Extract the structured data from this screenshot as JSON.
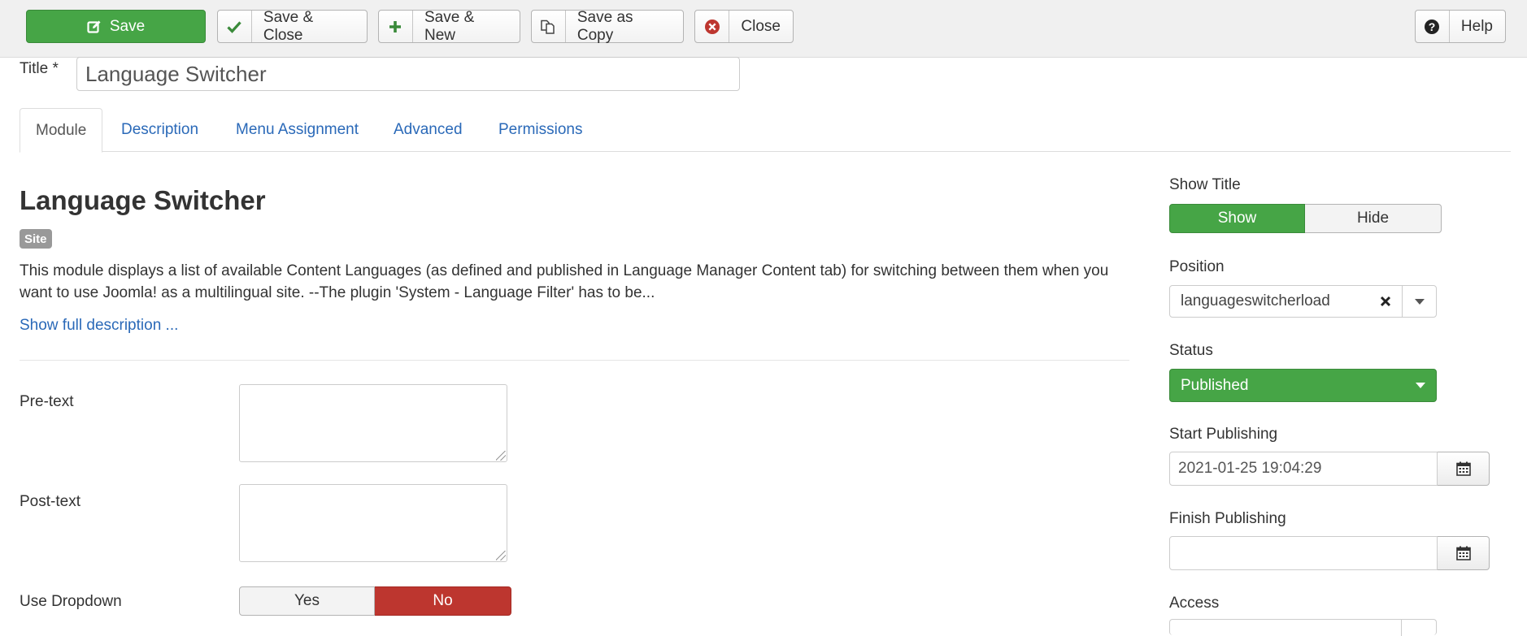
{
  "toolbar": {
    "save": "Save",
    "save_close": "Save & Close",
    "save_new": "Save & New",
    "save_copy": "Save as Copy",
    "close": "Close",
    "help": "Help"
  },
  "title_field": {
    "label": "Title *",
    "value": "Language Switcher"
  },
  "tabs": [
    {
      "label": "Module",
      "active": true
    },
    {
      "label": "Description",
      "active": false
    },
    {
      "label": "Menu Assignment",
      "active": false
    },
    {
      "label": "Advanced",
      "active": false
    },
    {
      "label": "Permissions",
      "active": false
    }
  ],
  "module": {
    "heading": "Language Switcher",
    "badge": "Site",
    "description": "This module displays a list of available Content Languages (as defined and published in Language Manager Content tab) for switching between them when you want to use Joomla! as a multilingual site. --The plugin 'System - Language Filter' has to be...",
    "show_full": "Show full description ..."
  },
  "fields": {
    "pretext_label": "Pre-text",
    "pretext_value": "",
    "posttext_label": "Post-text",
    "posttext_value": "",
    "dropdown_label": "Use Dropdown",
    "dropdown_yes": "Yes",
    "dropdown_no": "No",
    "dropdown_selected": "No"
  },
  "sidebar": {
    "show_title_label": "Show Title",
    "show_option": "Show",
    "hide_option": "Hide",
    "show_title_selected": "Show",
    "position_label": "Position",
    "position_value": "languageswitcherload",
    "status_label": "Status",
    "status_value": "Published",
    "start_label": "Start Publishing",
    "start_value": "2021-01-25 19:04:29",
    "finish_label": "Finish Publishing",
    "finish_value": "",
    "access_label": "Access"
  },
  "colors": {
    "success": "#46a546",
    "danger": "#bd362f",
    "link": "#2a69b8"
  }
}
